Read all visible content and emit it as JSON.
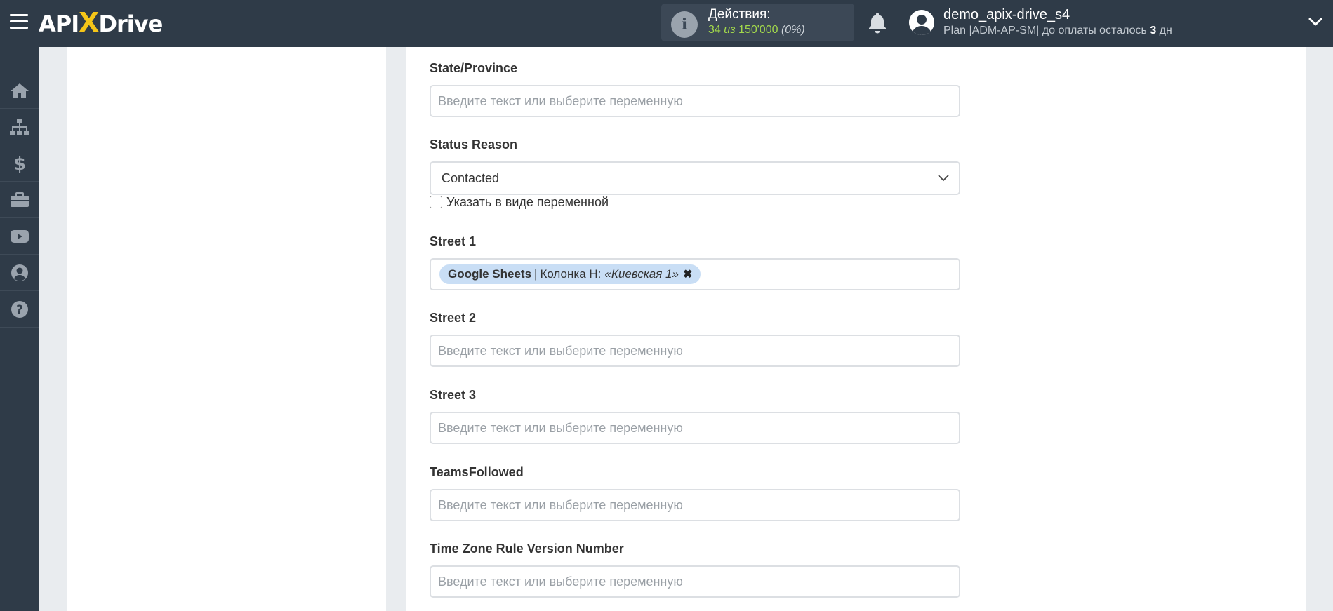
{
  "header": {
    "logo_text_before": "API",
    "logo_x": "X",
    "logo_text_after": "Drive",
    "actions": {
      "title": "Действия:",
      "used": "34",
      "of": "из",
      "total": "150'000",
      "percent": "(0%)"
    },
    "user": {
      "name": "demo_apix-drive_s4",
      "plan_prefix": "Plan |ADM-AP-SM| до оплаты осталось ",
      "days_left": "3",
      "days_unit": " дн"
    }
  },
  "sidebar": {
    "items": [
      {
        "icon": "home-icon"
      },
      {
        "icon": "sitemap-icon"
      },
      {
        "icon": "dollar-icon"
      },
      {
        "icon": "briefcase-icon"
      },
      {
        "icon": "youtube-icon"
      },
      {
        "icon": "user-circle-icon"
      },
      {
        "icon": "question-icon"
      }
    ]
  },
  "form": {
    "placeholder": "Введите текст или выберите переменную",
    "state_province": {
      "label": "State/Province",
      "value": ""
    },
    "status_reason": {
      "label": "Status Reason",
      "selected": "Contacted",
      "as_variable_label": "Указать в виде переменной"
    },
    "street1": {
      "label": "Street 1",
      "tag": {
        "source": "Google Sheets",
        "separator": "|",
        "column": "Колонка H:",
        "value": "«Киевская 1»",
        "remove": "✖"
      }
    },
    "street2": {
      "label": "Street 2",
      "value": ""
    },
    "street3": {
      "label": "Street 3",
      "value": ""
    },
    "teams_followed": {
      "label": "TeamsFollowed",
      "value": ""
    },
    "tz_rule": {
      "label": "Time Zone Rule Version Number",
      "value": ""
    }
  },
  "colors": {
    "topbar": "#2f3b48",
    "accent_yellow": "#f5c518",
    "actions_green": "#a3d94b",
    "tag_bg": "#c9def5"
  }
}
